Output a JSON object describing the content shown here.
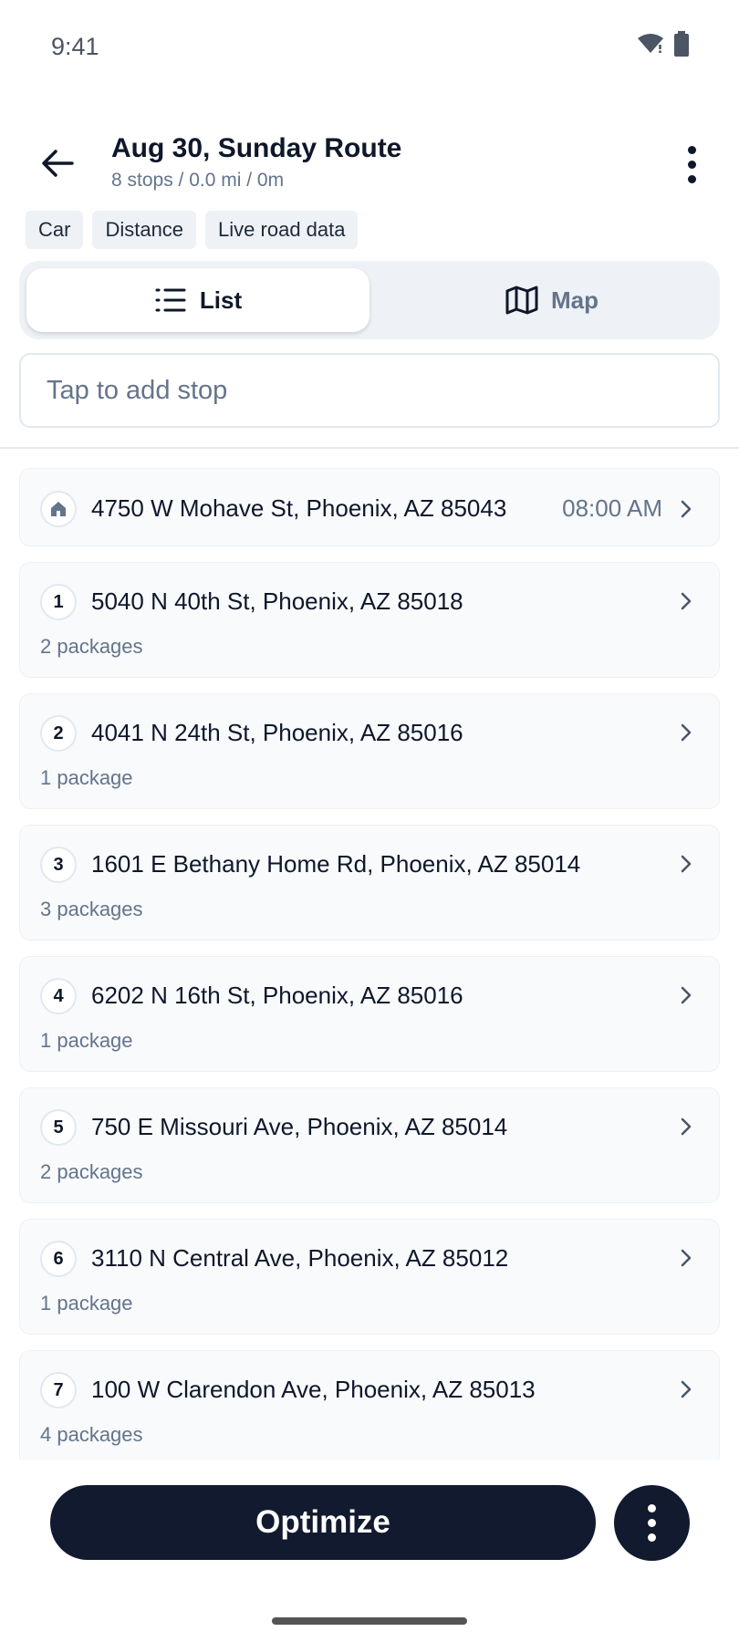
{
  "status": {
    "time": "9:41"
  },
  "header": {
    "title": "Aug 30, Sunday Route",
    "subtitle": "8 stops / 0.0 mi / 0m"
  },
  "chips": [
    "Car",
    "Distance",
    "Live road data"
  ],
  "view_toggle": {
    "list_label": "List",
    "map_label": "Map",
    "selected": "List"
  },
  "add_stop": {
    "placeholder": "Tap to add stop"
  },
  "start": {
    "address": "4750 W Mohave St, Phoenix, AZ 85043",
    "time": "08:00 AM"
  },
  "stops": [
    {
      "num": "1",
      "address": "5040 N 40th St, Phoenix, AZ 85018",
      "packages": "2 packages"
    },
    {
      "num": "2",
      "address": "4041 N 24th St, Phoenix, AZ 85016",
      "packages": "1 package"
    },
    {
      "num": "3",
      "address": "1601 E Bethany Home Rd, Phoenix, AZ 85014",
      "packages": "3 packages"
    },
    {
      "num": "4",
      "address": "6202 N 16th St, Phoenix, AZ 85016",
      "packages": "1 package"
    },
    {
      "num": "5",
      "address": "750 E Missouri Ave, Phoenix, AZ 85014",
      "packages": "2 packages"
    },
    {
      "num": "6",
      "address": "3110 N Central Ave, Phoenix, AZ 85012",
      "packages": "1 package"
    },
    {
      "num": "7",
      "address": "100 W Clarendon Ave, Phoenix, AZ 85013",
      "packages": "4 packages"
    }
  ],
  "actions": {
    "optimize_label": "Optimize"
  }
}
